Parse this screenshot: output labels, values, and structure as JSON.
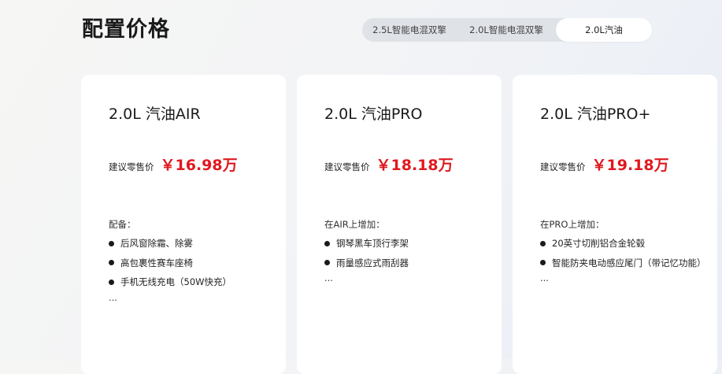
{
  "page": {
    "title": "配置价格"
  },
  "tabs": [
    {
      "label": "2.5L智能电混双擎",
      "active": false
    },
    {
      "label": "2.0L智能电混双擎",
      "active": false
    },
    {
      "label": "2.0L汽油",
      "active": true
    }
  ],
  "cards": [
    {
      "name": "2.0L 汽油AIR",
      "price_label": "建议零售价",
      "price": "￥16.98万",
      "features_heading": "配备：",
      "features": [
        "后风窗除霜、除雾",
        "高包裹性赛车座椅",
        "手机无线充电（50W快充）"
      ],
      "more": "..."
    },
    {
      "name": "2.0L 汽油PRO",
      "price_label": "建议零售价",
      "price": "￥18.18万",
      "features_heading": "在AIR上增加：",
      "features": [
        "钢琴黑车顶行李架",
        "雨量感应式雨刮器"
      ],
      "more": "..."
    },
    {
      "name": "2.0L 汽油PRO+",
      "price_label": "建议零售价",
      "price": "￥19.18万",
      "features_heading": "在PRO上增加：",
      "features": [
        "20英寸切削铝合金轮毂",
        "智能防夹电动感应尾门（带记忆功能）"
      ],
      "more": "..."
    }
  ],
  "colors": {
    "price": "#e0191f",
    "tab_track": "#dfe2e6",
    "card": "#ffffff"
  }
}
